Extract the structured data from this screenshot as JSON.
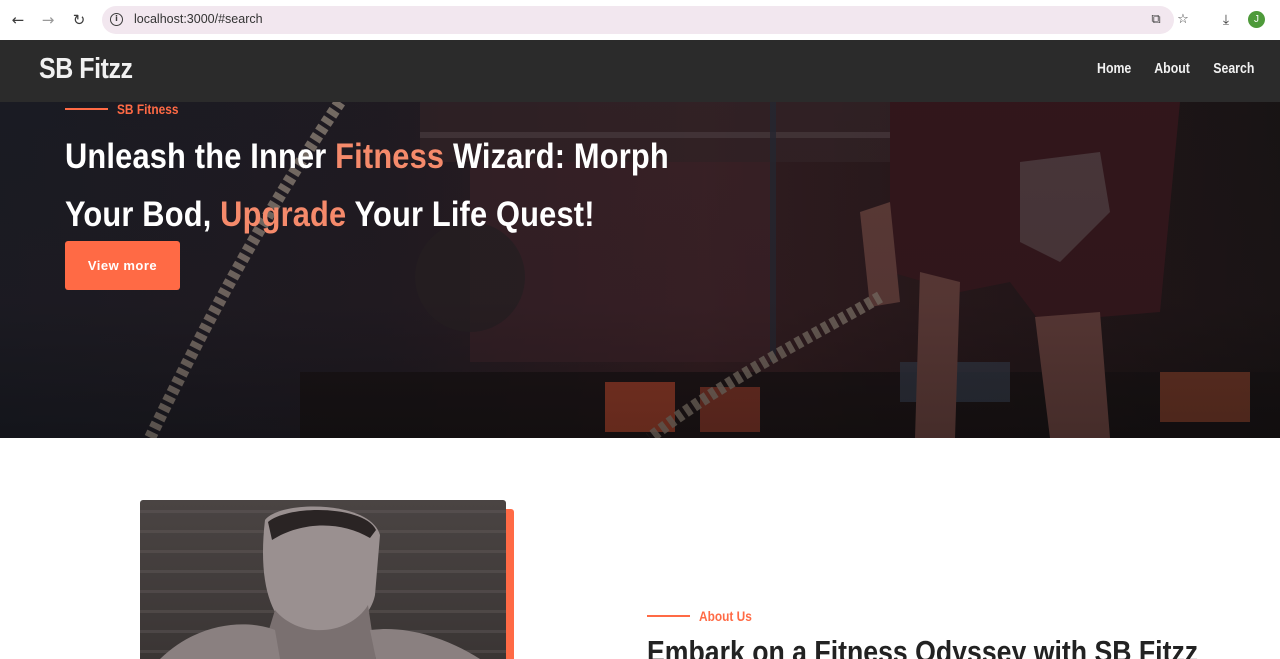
{
  "browser": {
    "url": "localhost:3000/#search",
    "profile_initial": "J"
  },
  "navbar": {
    "brand": "SB Fitzz",
    "links": [
      "Home",
      "About",
      "Search"
    ]
  },
  "hero": {
    "eyebrow": "SB Fitness",
    "title_parts": [
      "Unleash the Inner ",
      "Fitness",
      " Wizard: Morph Your Bod, ",
      "Upgrade",
      " Your Life Quest!"
    ],
    "button_label": "View more",
    "accent_color": "#ff6a45",
    "highlight_color": "#f58a6b"
  },
  "about": {
    "eyebrow": "About Us",
    "heading": "Embark on a Fitness Odyssey with SB Fitzz"
  }
}
